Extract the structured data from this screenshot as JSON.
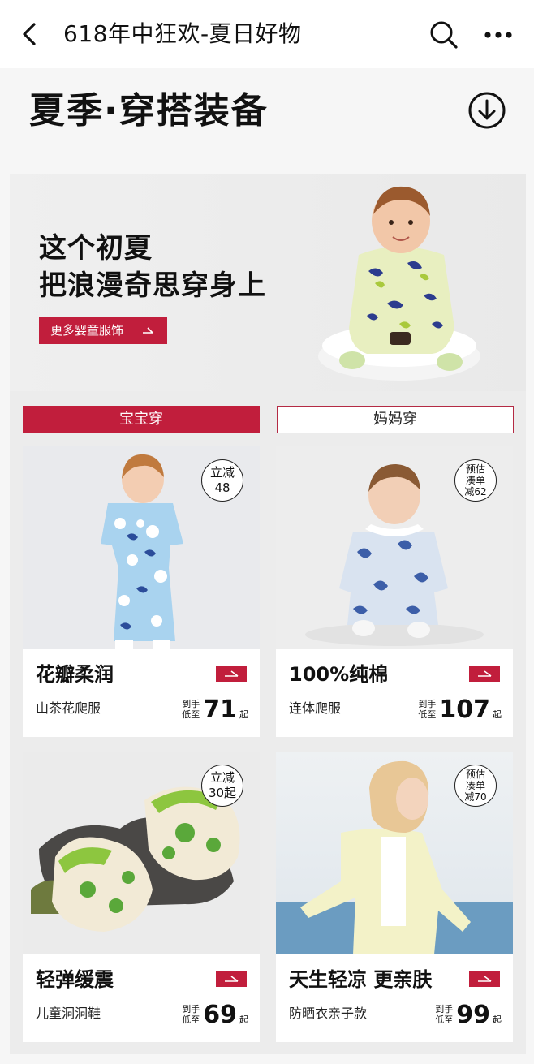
{
  "nav": {
    "title": "618年中狂欢-夏日好物",
    "icons": [
      "back-icon",
      "search-icon",
      "more-icon"
    ]
  },
  "section": {
    "title": "夏季·穿搭装备",
    "icon": "download-icon"
  },
  "hero": {
    "line1": "这个初夏",
    "line2": "把浪漫奇思穿身上",
    "button": "更多婴童服饰"
  },
  "tabs": [
    {
      "label": "宝宝穿",
      "active": true
    },
    {
      "label": "妈妈穿",
      "active": false
    }
  ],
  "products": [
    {
      "title": "花瓣柔润",
      "subtitle": "山茶花爬服",
      "badge": [
        "立减",
        "48"
      ],
      "price_label": [
        "到手",
        "低至"
      ],
      "price": "71",
      "suffix": "起"
    },
    {
      "title": "100%纯棉",
      "subtitle": "连体爬服",
      "badge": [
        "预估",
        "凑单",
        "减62"
      ],
      "price_label": [
        "到手",
        "低至"
      ],
      "price": "107",
      "suffix": "起"
    },
    {
      "title": "轻弹缓震",
      "subtitle": "儿童洞洞鞋",
      "badge": [
        "立减",
        "30起"
      ],
      "price_label": [
        "到手",
        "低至"
      ],
      "price": "69",
      "suffix": "起"
    },
    {
      "title": "天生轻凉 更亲肤",
      "subtitle": "防晒衣亲子款",
      "badge": [
        "预估",
        "凑单",
        "减70"
      ],
      "price_label": [
        "到手",
        "低至"
      ],
      "price": "99",
      "suffix": "起"
    }
  ],
  "colors": {
    "accent": "#c11e3c",
    "background": "#f6f6f6",
    "panel": "#ececec"
  }
}
